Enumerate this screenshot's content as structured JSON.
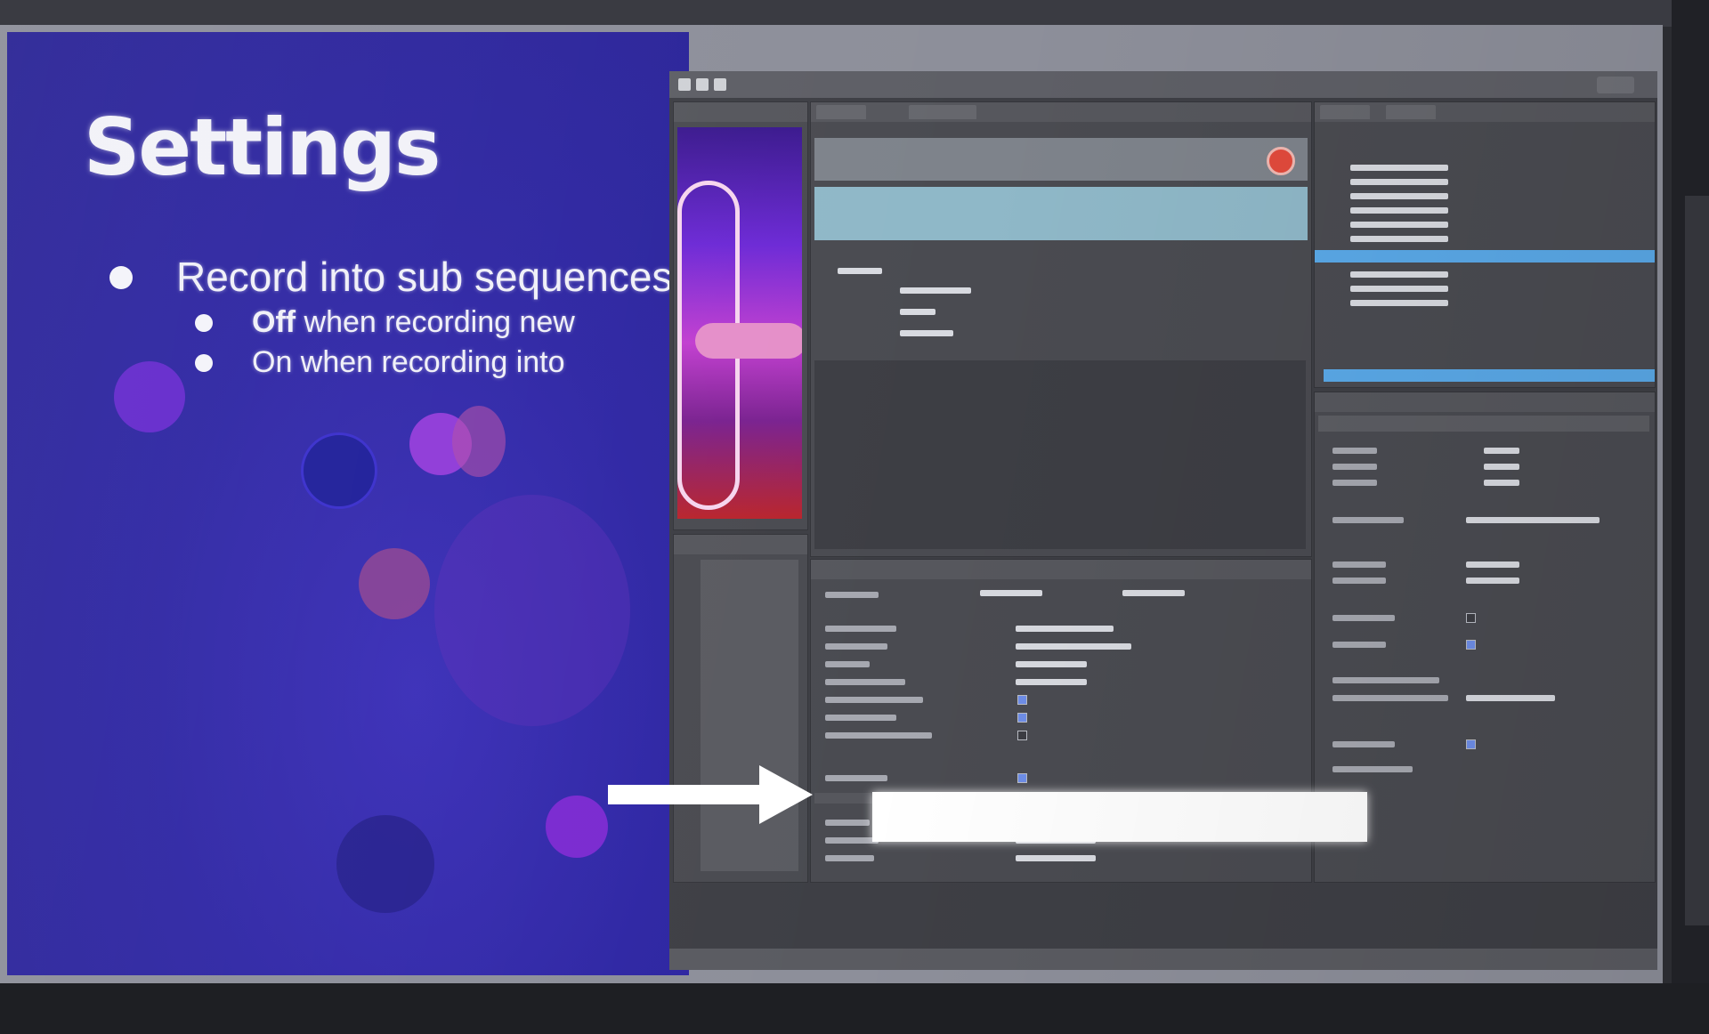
{
  "slide": {
    "title": "Settings",
    "bullet": "Record into sub sequences",
    "sub_bullets": [
      {
        "keyword": "Off",
        "rest": " when recording new"
      },
      {
        "keyword": "On",
        "rest": " when recording into"
      }
    ]
  },
  "editor": {
    "colors": {
      "record": "#e24a3c",
      "selection": "#5aa9e8",
      "slide_background": "#2f27a4"
    },
    "icons": [
      "record-icon",
      "arrow-right-icon",
      "play-icon",
      "lock-icon",
      "search-icon"
    ]
  }
}
